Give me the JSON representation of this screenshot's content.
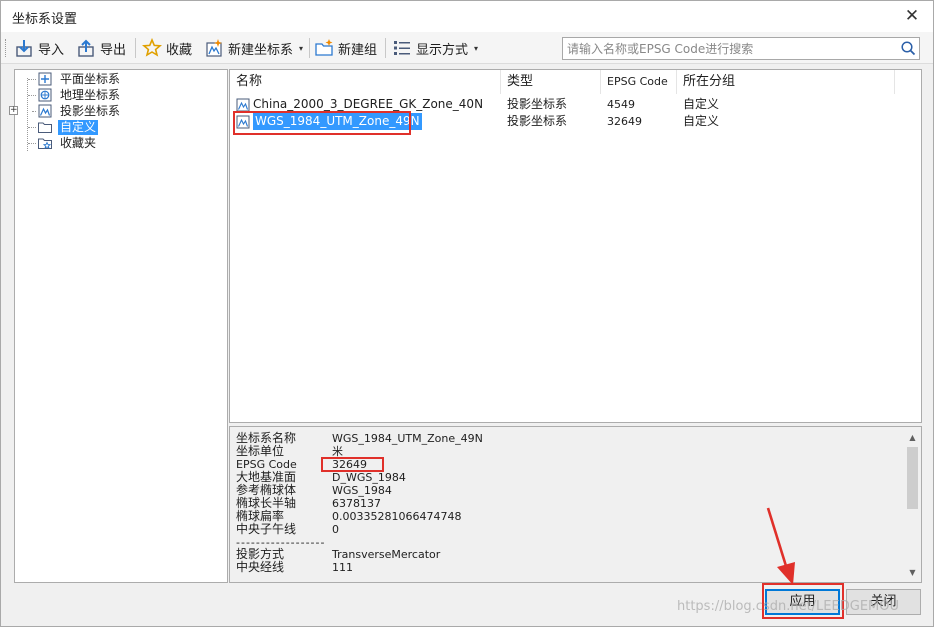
{
  "window": {
    "title": "坐标系设置",
    "close_symbol": "✕"
  },
  "toolbar": {
    "import_label": "导入",
    "export_label": "导出",
    "favorite_label": "收藏",
    "new_crs_label": "新建坐标系",
    "new_group_label": "新建组",
    "display_label": "显示方式",
    "caret": "▾"
  },
  "search": {
    "placeholder": "请输入名称或EPSG Code进行搜索",
    "value": ""
  },
  "tree": {
    "items": [
      {
        "label": "平面坐标系",
        "icon": "planar-crs-icon",
        "selected": false
      },
      {
        "label": "地理坐标系",
        "icon": "geographic-crs-icon",
        "selected": false
      },
      {
        "label": "投影坐标系",
        "icon": "projected-crs-icon",
        "selected": false,
        "expandable": true,
        "expander": "+"
      },
      {
        "label": "自定义",
        "icon": "folder-icon",
        "selected": true
      },
      {
        "label": "收藏夹",
        "icon": "favorites-folder-icon",
        "selected": false
      }
    ]
  },
  "list": {
    "columns": [
      "名称",
      "类型",
      "EPSG Code",
      "所在分组"
    ],
    "rows": [
      {
        "name": "China_2000_3_DEGREE_GK_Zone_40N",
        "type": "投影坐标系",
        "epsg": "4549",
        "group": "自定义",
        "selected": false
      },
      {
        "name": "WGS_1984_UTM_Zone_49N",
        "type": "投影坐标系",
        "epsg": "32649",
        "group": "自定义",
        "selected": true
      }
    ]
  },
  "properties": {
    "rows": [
      {
        "key": "坐标系名称",
        "value": "WGS_1984_UTM_Zone_49N"
      },
      {
        "key": "坐标单位",
        "value": "米"
      },
      {
        "key": "EPSG Code",
        "value": "32649"
      },
      {
        "key": "大地基准面",
        "value": "D_WGS_1984"
      },
      {
        "key": "参考椭球体",
        "value": "WGS_1984"
      },
      {
        "key": "椭球长半轴",
        "value": "6378137"
      },
      {
        "key": "椭球扁率",
        "value": "0.00335281066474748"
      },
      {
        "key": "中央子午线",
        "value": "0"
      },
      {
        "key": "------------------",
        "value": ""
      },
      {
        "key": "投影方式",
        "value": "TransverseMercator"
      },
      {
        "key": "中央经线",
        "value": "111"
      }
    ],
    "scroll_up": "▲",
    "scroll_down": "▼"
  },
  "buttons": {
    "apply_label": "应用",
    "close_label": "关闭"
  },
  "watermark": "https://blog.csdn.net/LEEDGEMOU",
  "colors": {
    "selection": "#3399ff",
    "annotation_red": "#e0302a",
    "accent": "#0078d7"
  }
}
